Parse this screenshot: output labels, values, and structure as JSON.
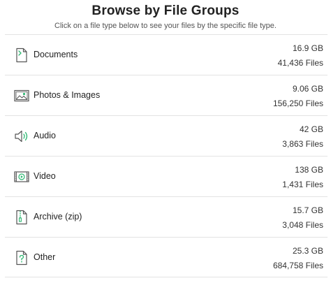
{
  "header": {
    "title": "Browse by File Groups",
    "subtitle": "Click on a file type below to see your files by the specific file type."
  },
  "accent_color": "#2eb872",
  "file_groups": [
    {
      "label": "Documents",
      "size": "16.9 GB",
      "count": "41,436 Files",
      "icon": "document-icon"
    },
    {
      "label": "Photos & Images",
      "size": "9.06 GB",
      "count": "156,250 Files",
      "icon": "image-icon"
    },
    {
      "label": "Audio",
      "size": "42 GB",
      "count": "3,863 Files",
      "icon": "speaker-icon"
    },
    {
      "label": "Video",
      "size": "138 GB",
      "count": "1,431 Files",
      "icon": "video-icon"
    },
    {
      "label": "Archive (zip)",
      "size": "15.7 GB",
      "count": "3,048 Files",
      "icon": "zip-archive-icon"
    },
    {
      "label": "Other",
      "size": "25.3 GB",
      "count": "684,758 Files",
      "icon": "question-file-icon"
    }
  ]
}
